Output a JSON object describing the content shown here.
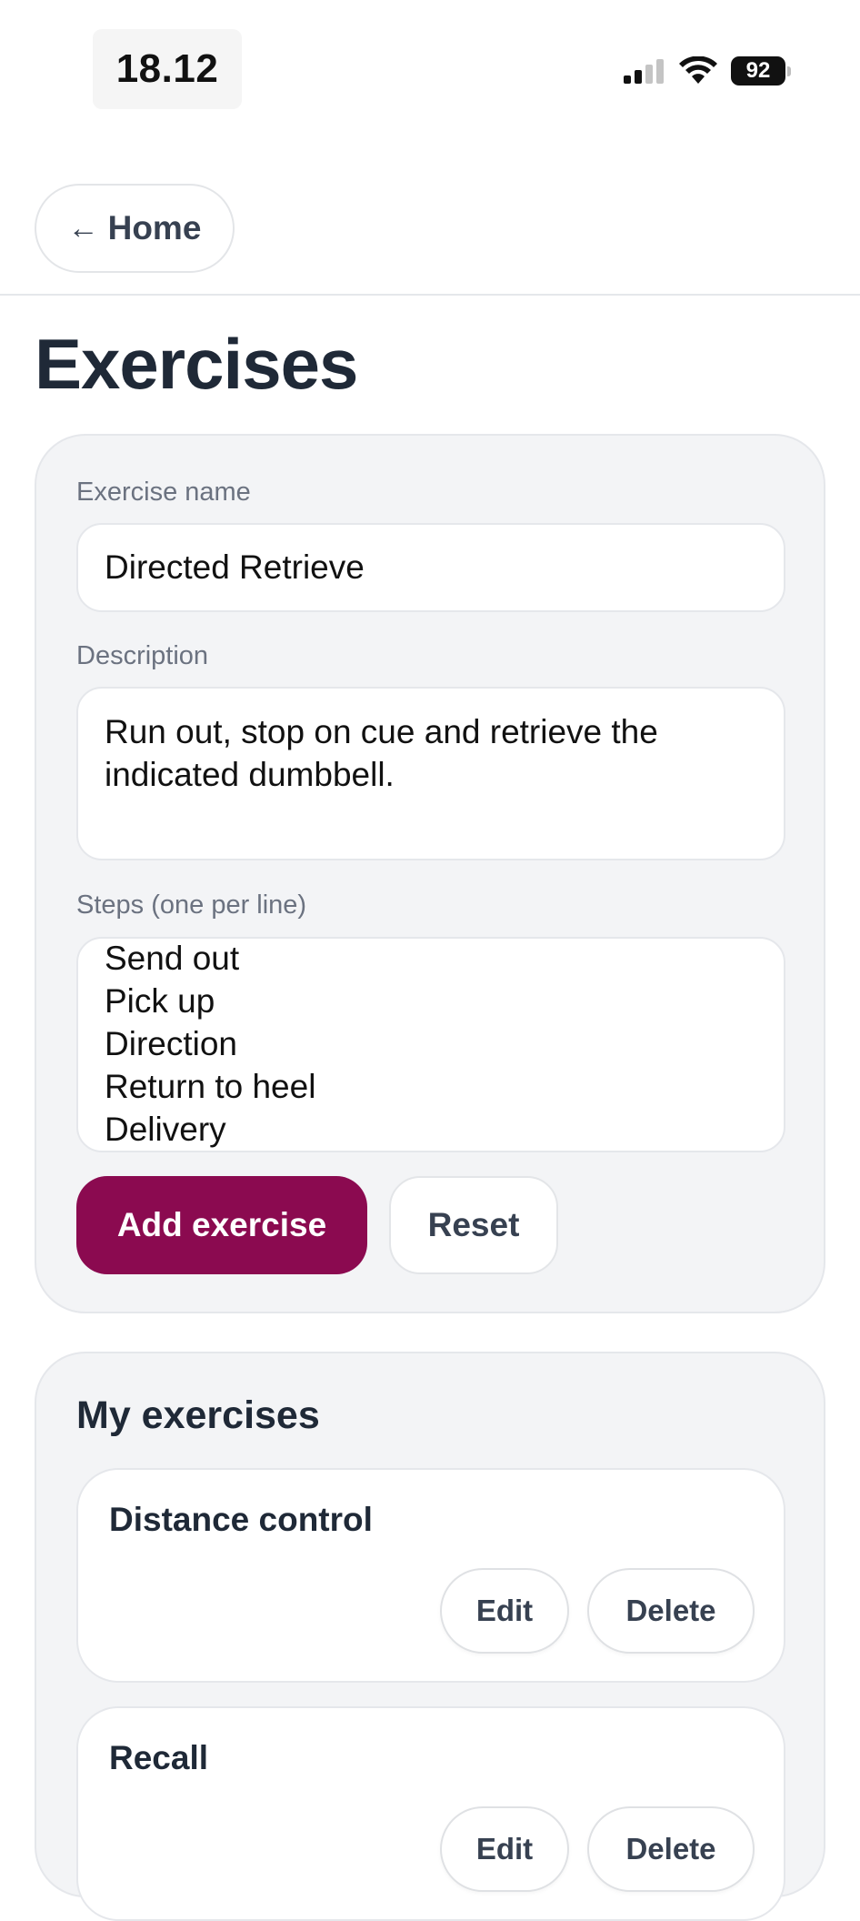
{
  "status_bar": {
    "time": "18.12",
    "battery": "92",
    "icons": [
      "signal-icon",
      "wifi-icon",
      "battery-icon"
    ]
  },
  "header": {
    "home_label": "Home",
    "back_icon": "arrow-left-icon"
  },
  "page": {
    "title": "Exercises"
  },
  "form": {
    "name_label": "Exercise name",
    "name_value": "Directed Retrieve",
    "description_label": "Description",
    "description_value": "Run out, stop on cue and retrieve the indicated dumbbell.",
    "steps_label": "Steps (one per line)",
    "steps": [
      "Send out",
      "Pick up",
      "Direction",
      "Return to heel",
      "Delivery"
    ],
    "add_label": "Add exercise",
    "reset_label": "Reset"
  },
  "list": {
    "title": "My exercises",
    "items": [
      {
        "name": "Distance control",
        "edit_label": "Edit",
        "delete_label": "Delete"
      },
      {
        "name": "Recall",
        "edit_label": "Edit",
        "delete_label": "Delete"
      }
    ]
  },
  "colors": {
    "accent": "#8b0a50",
    "card_background": "#f3f4f6",
    "text_dark": "#1f2937",
    "text_muted": "#6b7280"
  }
}
